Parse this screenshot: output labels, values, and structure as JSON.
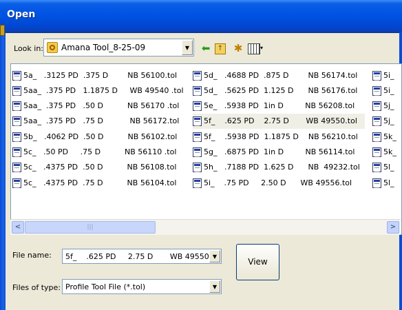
{
  "window": {
    "title": "Open"
  },
  "look_in": {
    "label": "Look in:",
    "value": "Amana Tool_8-25-09"
  },
  "toolbar": {
    "icons": [
      "back-icon",
      "up-folder-icon",
      "new-folder-icon",
      "view-menu-icon"
    ]
  },
  "files": [
    [
      "5a_   .3125 PD  .375 D        NB 56100.tol",
      "5d_   .4688 PD  .875 D        NB 56174.tol",
      "5i_"
    ],
    [
      "5aa_  .375 PD   1.1875 D     WB 49540 .tol",
      "5d_   .5625 PD  1.125 D      NB 56176.tol",
      "5i_"
    ],
    [
      "5aa_  .375 PD   .50 D          NB 56170 .tol",
      "5e_   .5938 PD  1in D         NB 56208.tol",
      "5j_"
    ],
    [
      "5aa_  .375 PD   .75 D           NB 56172.tol",
      "5f_    .625 PD    2.75 D       WB 49550.tol",
      "5j_"
    ],
    [
      "5b_   .4062 PD  .50 D          NB 56102.tol",
      "5f_    .5938 PD  1.1875 D    NB 56210.tol",
      "5k_"
    ],
    [
      "5c_   .50 PD     .75 D          NB 56110 .tol",
      "5g_   .6875 PD  1in D         NB 56114.tol",
      "5k_"
    ],
    [
      "5c_   .4375 PD  .50 D          NB 56108.tol",
      "5h_   .7188 PD  1.625 D      NB  49232.tol",
      "5l_"
    ],
    [
      "5c_   .4375 PD  .75 D          NB 56104.tol",
      "5i_    .75 PD     2.50 D      WB 49556.tol",
      "5l_"
    ]
  ],
  "file_name": {
    "label": "File name:",
    "value": "5f_    .625 PD     2.75 D       WB 49550"
  },
  "files_of_type": {
    "label": "Files of type:",
    "value": "Profile Tool File (*.tol)"
  },
  "buttons": {
    "view": "View"
  }
}
